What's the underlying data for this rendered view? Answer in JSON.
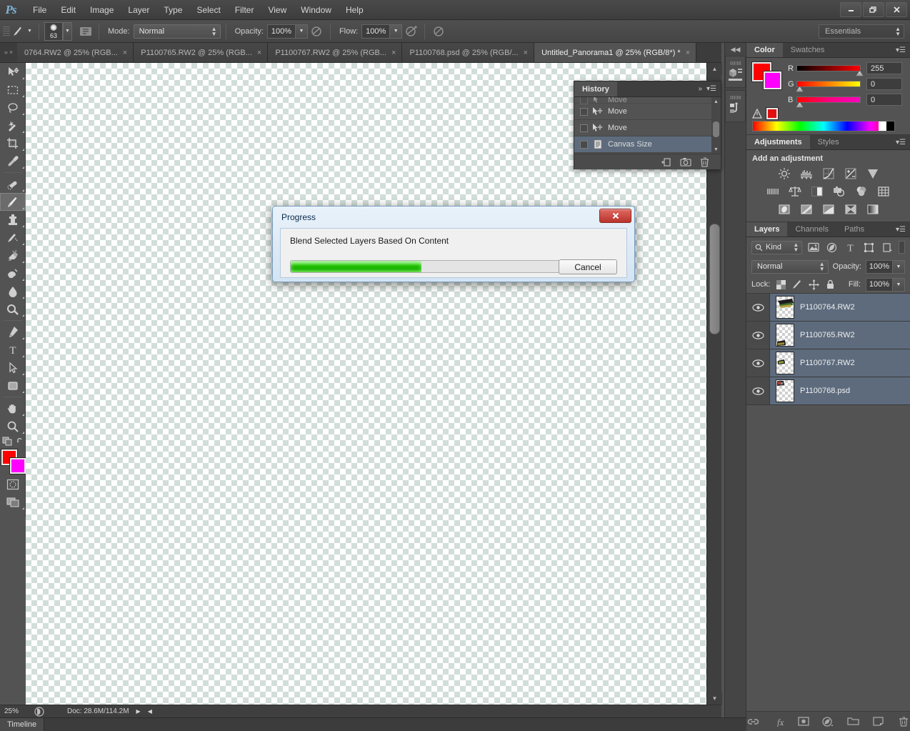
{
  "app": {
    "name": "Ps"
  },
  "window_controls": {
    "minimize": "—",
    "restore": "❐",
    "close": "✕"
  },
  "menubar": {
    "items": [
      "File",
      "Edit",
      "Image",
      "Layer",
      "Type",
      "Select",
      "Filter",
      "View",
      "Window",
      "Help"
    ]
  },
  "options_bar": {
    "brush_size": "63",
    "mode_label": "Mode:",
    "mode_value": "Normal",
    "opacity_label": "Opacity:",
    "opacity_value": "100%",
    "flow_label": "Flow:",
    "flow_value": "100%",
    "workspace": "Essentials"
  },
  "tabs": {
    "items": [
      {
        "label": "0764.RW2 @ 25% (RGB...",
        "active": false
      },
      {
        "label": "P1100765.RW2 @ 25% (RGB...",
        "active": false
      },
      {
        "label": "P1100767.RW2 @ 25% (RGB...",
        "active": false
      },
      {
        "label": "P1100768.psd @ 25% (RGB/...",
        "active": false
      },
      {
        "label": "Untitled_Panorama1 @ 25% (RGB/8*) *",
        "active": true
      }
    ],
    "close_glyph": "×"
  },
  "tools": {
    "items": [
      {
        "name": "move-tool",
        "selected": false
      },
      {
        "name": "rectangular-marquee-tool",
        "selected": false
      },
      {
        "name": "lasso-tool",
        "selected": false
      },
      {
        "name": "magic-wand-tool",
        "selected": false
      },
      {
        "name": "crop-tool",
        "selected": false
      },
      {
        "name": "eyedropper-tool",
        "selected": false
      },
      {
        "name": "spot-healing-brush-tool",
        "selected": false
      },
      {
        "name": "brush-tool",
        "selected": true
      },
      {
        "name": "clone-stamp-tool",
        "selected": false
      },
      {
        "name": "history-brush-tool",
        "selected": false
      },
      {
        "name": "eraser-tool",
        "selected": false
      },
      {
        "name": "gradient-tool",
        "selected": false
      },
      {
        "name": "blur-tool",
        "selected": false
      },
      {
        "name": "dodge-tool",
        "selected": false
      },
      {
        "name": "pen-tool",
        "selected": false
      },
      {
        "name": "type-tool",
        "selected": false
      },
      {
        "name": "path-selection-tool",
        "selected": false
      },
      {
        "name": "rectangle-tool",
        "selected": false
      },
      {
        "name": "hand-tool",
        "selected": false
      },
      {
        "name": "zoom-tool",
        "selected": false
      }
    ],
    "foreground_color": "#ff0000",
    "background_color": "#ff00ff"
  },
  "history_panel": {
    "tab": "History",
    "items": [
      {
        "label": "Move",
        "icon": "move-icon",
        "selected": false
      },
      {
        "label": "Move",
        "icon": "move-icon",
        "selected": false
      },
      {
        "label": "Canvas Size",
        "icon": "document-icon",
        "selected": true
      }
    ],
    "footer_icons": [
      "new-document-from-state-icon",
      "new-snapshot-icon",
      "delete-icon"
    ]
  },
  "color_panel": {
    "tabs": [
      "Color",
      "Swatches"
    ],
    "active_tab": "Color",
    "channels": [
      {
        "label": "R",
        "value": "255"
      },
      {
        "label": "G",
        "value": "0"
      },
      {
        "label": "B",
        "value": "0"
      }
    ],
    "foreground_color": "#ff0000",
    "background_color": "#ff00ff",
    "alpha_swatch": "#e01010"
  },
  "adjustments_panel": {
    "tabs": [
      "Adjustments",
      "Styles"
    ],
    "active_tab": "Adjustments",
    "title": "Add an adjustment",
    "rows": [
      [
        "brightness-contrast-icon",
        "levels-icon",
        "curves-icon",
        "exposure-icon",
        "vibrance-icon"
      ],
      [
        "hue-saturation-icon",
        "color-balance-icon",
        "black-white-icon",
        "photo-filter-icon",
        "channel-mixer-icon",
        "color-lookup-icon"
      ],
      [
        "invert-icon",
        "posterize-icon",
        "threshold-icon",
        "selective-color-icon",
        "gradient-map-icon"
      ]
    ]
  },
  "layers_panel": {
    "tabs": [
      "Layers",
      "Channels",
      "Paths"
    ],
    "active_tab": "Layers",
    "filter_kind": "Kind",
    "filter_icons": [
      "filter-pixel-icon",
      "filter-adjustment-icon",
      "filter-type-icon",
      "filter-shape-icon",
      "filter-smart-object-icon"
    ],
    "blend_mode": "Normal",
    "opacity_label": "Opacity:",
    "opacity_value": "100%",
    "lock_label": "Lock:",
    "lock_icons": [
      "lock-transparency-icon",
      "lock-image-icon",
      "lock-position-icon",
      "lock-all-icon"
    ],
    "fill_label": "Fill:",
    "fill_value": "100%",
    "layers": [
      {
        "name": "P1100764.RW2",
        "visible": true,
        "selected": true
      },
      {
        "name": "P1100765.RW2",
        "visible": true,
        "selected": true
      },
      {
        "name": "P1100767.RW2",
        "visible": true,
        "selected": true
      },
      {
        "name": "P1100768.psd",
        "visible": true,
        "selected": true
      }
    ],
    "footer_icons": [
      "link-layers-icon",
      "layer-style-fx-icon",
      "add-layer-mask-icon",
      "new-adjustment-layer-icon",
      "new-group-icon",
      "new-layer-icon",
      "delete-layer-icon"
    ]
  },
  "status_bar": {
    "zoom": "25%",
    "doc_info": "Doc: 28.6M/114.2M",
    "timeline_tab": "Timeline"
  },
  "dialog": {
    "title": "Progress",
    "message": "Blend Selected Layers Based On Content",
    "progress_percent": 48,
    "cancel_label": "Cancel",
    "close_glyph": "✕"
  }
}
